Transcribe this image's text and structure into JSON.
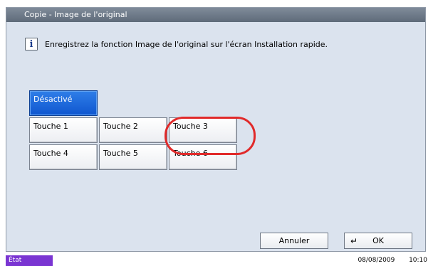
{
  "window": {
    "title": "Copie - Image de l'original"
  },
  "info": {
    "icon": "info-icon",
    "message": "Enregistrez la fonction Image de l'original sur l'écran Installation rapide."
  },
  "options": {
    "selected_label": "Désactivé",
    "touches": [
      "Touche 1",
      "Touche 2",
      "Touche 3",
      "Touche 4",
      "Touche 5",
      "Touche 6"
    ]
  },
  "footer": {
    "cancel_label": "Annuler",
    "ok_label": "OK",
    "ok_icon": "enter-arrow-icon"
  },
  "status_bar": {
    "status_label": "État",
    "date": "08/08/2009",
    "time": "10:10"
  },
  "colors": {
    "selected_button": "#1565d8",
    "highlight_ring": "#e12a2a",
    "panel_background": "#dbe3ee",
    "status_tab": "#7a35d2"
  }
}
